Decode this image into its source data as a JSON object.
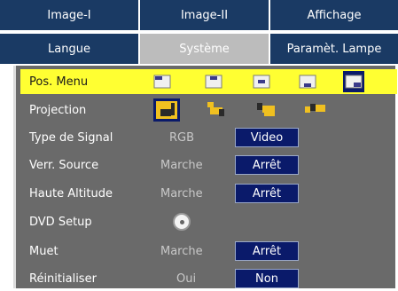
{
  "tabs_row1": [
    {
      "label": "Image-I"
    },
    {
      "label": "Image-II"
    },
    {
      "label": "Affichage"
    }
  ],
  "tabs_row2": [
    {
      "label": "Langue"
    },
    {
      "label": "Système",
      "active": true
    },
    {
      "label": "Paramèt. Lampe"
    }
  ],
  "menu": {
    "pos_menu": {
      "label": "Pos. Menu",
      "options": [
        "top-left-icon",
        "top-center-icon",
        "center-icon",
        "bottom-center-icon",
        "bottom-right-icon"
      ],
      "selected_index": 4
    },
    "projection": {
      "label": "Projection",
      "options": [
        "front-desktop-icon",
        "rear-desktop-icon",
        "front-ceiling-icon",
        "rear-ceiling-icon"
      ],
      "selected_index": 0
    },
    "type_signal": {
      "label": "Type de Signal",
      "off": "RGB",
      "on": "Video"
    },
    "verr_source": {
      "label": "Verr. Source",
      "off": "Marche",
      "on": "Arrêt"
    },
    "haute_alt": {
      "label": "Haute Altitude",
      "off": "Marche",
      "on": "Arrêt"
    },
    "dvd_setup": {
      "label": "DVD Setup"
    },
    "muet": {
      "label": "Muet",
      "off": "Marche",
      "on": "Arrêt"
    },
    "reinit": {
      "label": "Réinitialiser",
      "off": "Oui",
      "on": "Non"
    }
  },
  "colors": {
    "tab_bg": "#1a3a64",
    "panel_bg": "#6a6a6a",
    "highlight": "#ffff32",
    "selected_box": "#0a1a6a"
  }
}
